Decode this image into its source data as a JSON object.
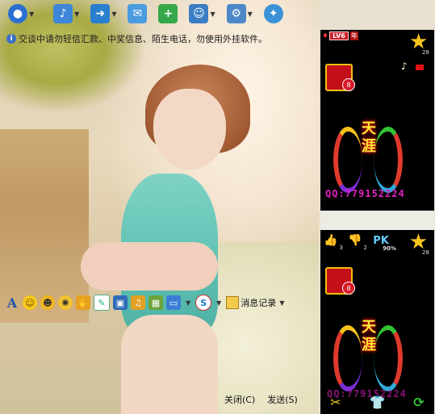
{
  "notice": {
    "text": "交谈中请勿轻信汇款、中奖信息、陌生电话，勿使用外挂软件。"
  },
  "toolbar": {
    "items": [
      {
        "name": "video-icon",
        "color": "#2b6fd1"
      },
      {
        "name": "voice-icon",
        "color": "#3d86d8"
      },
      {
        "name": "file-transfer-icon",
        "color": "#2a7fcf"
      },
      {
        "name": "mail-icon",
        "color": "#4a9be0"
      },
      {
        "name": "app-add-icon",
        "color": "#37a84a"
      },
      {
        "name": "member-icon",
        "color": "#3b7ec4"
      },
      {
        "name": "settings-icon",
        "color": "#4c88c8"
      },
      {
        "name": "tool-icon",
        "color": "#3a91d6"
      }
    ]
  },
  "input_toolbar": {
    "font_label": "A",
    "message_record_label": "消息记录"
  },
  "buttons": {
    "close": "关闭(C)",
    "send": "发送(S)"
  },
  "panel1": {
    "level": "LV6",
    "year": "年",
    "star_count": "28",
    "gift_count": "8",
    "emblem_text": "天\n涯",
    "qq": "QQ:779152224"
  },
  "panel2": {
    "thumb_count": "3",
    "down_count": "2",
    "pk_label": "PK",
    "percent": "90%",
    "star_count": "28",
    "gift_count": "8",
    "emblem_text": "天\n涯",
    "qq": "QQ:779152224"
  }
}
